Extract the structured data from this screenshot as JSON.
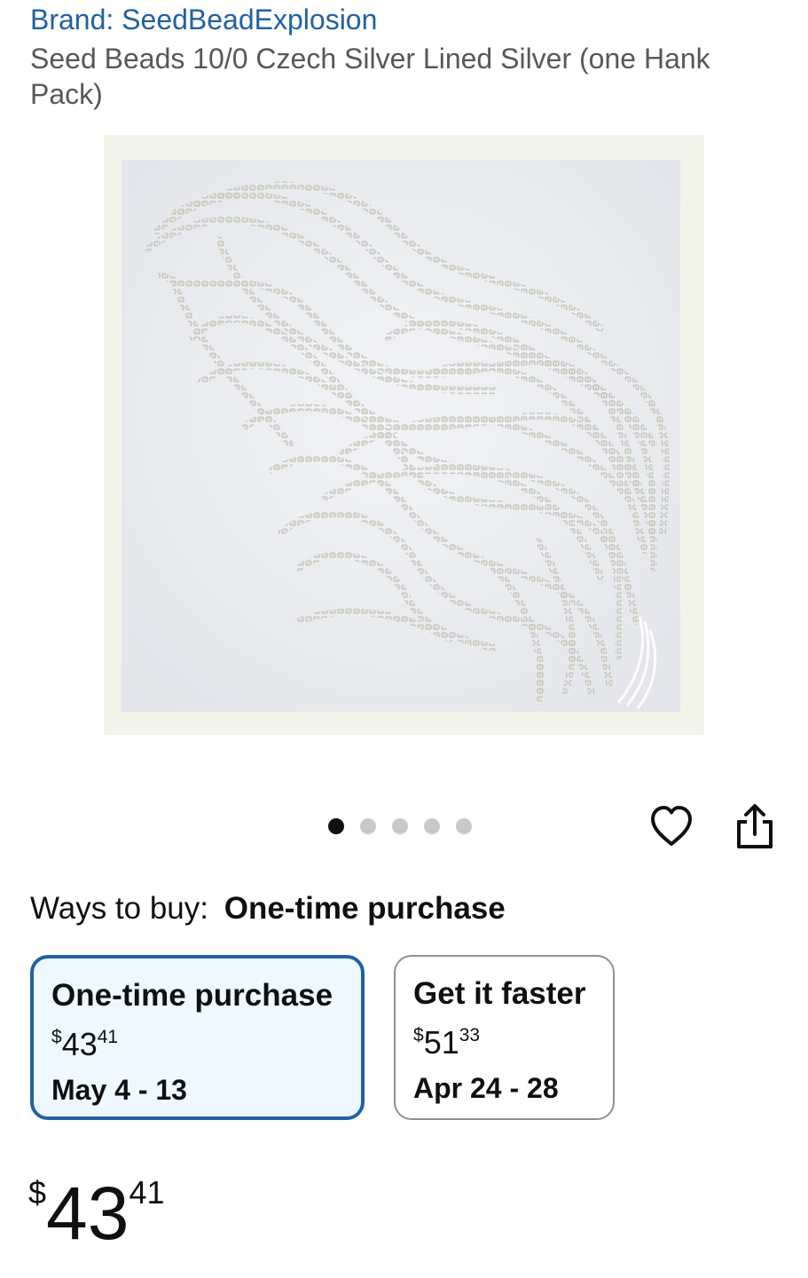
{
  "brand": {
    "text": "Brand: SeedBeadExplosion"
  },
  "product": {
    "title": "Seed Beads 10/0 Czech Silver Lined Silver (one Hank Pack)",
    "image": {
      "icon": "beads-product-photo",
      "frame_color": "#f3f4ea"
    }
  },
  "carousel": {
    "total_dots": 5,
    "active_index": 0
  },
  "actions": {
    "wishlist_icon": "heart-icon",
    "share_icon": "share-icon"
  },
  "ways_to_buy": {
    "label": "Ways to buy:",
    "selected_value": "One-time purchase"
  },
  "options": [
    {
      "title": "One-time purchase",
      "price_symbol": "$",
      "price_whole": "43",
      "price_cents": "41",
      "dates": "May 4 - 13",
      "selected": true
    },
    {
      "title": "Get it faster",
      "price_symbol": "$",
      "price_whole": "51",
      "price_cents": "33",
      "dates": "Apr 24 - 28",
      "selected": false
    }
  ],
  "price": {
    "symbol": "$",
    "whole": "43",
    "cents": "41"
  },
  "colors": {
    "link": "#2162a1",
    "selected_border": "#2162a1",
    "selected_bg": "#edf9fe",
    "text": "#0f1111",
    "secondary_text": "#565959"
  }
}
